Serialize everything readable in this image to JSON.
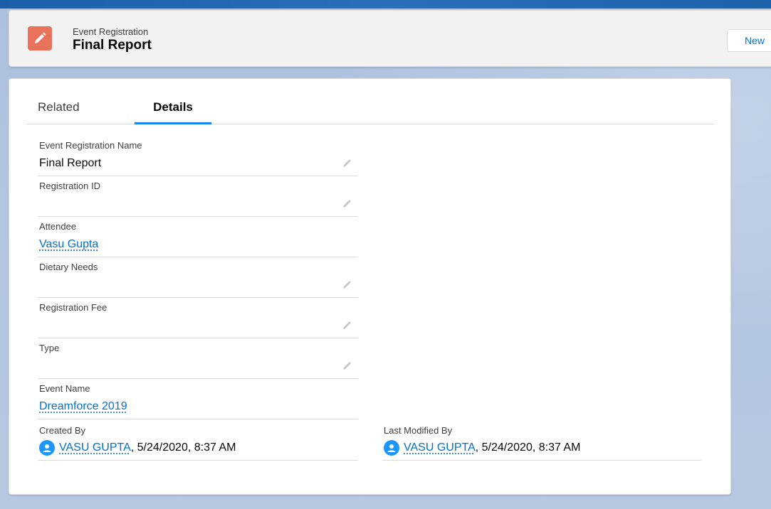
{
  "header": {
    "object_label": "Event Registration",
    "record_title": "Final Report",
    "new_button_label": "New",
    "icon_color": "#e8735a"
  },
  "tabs": [
    {
      "label": "Related",
      "active": false
    },
    {
      "label": "Details",
      "active": true
    }
  ],
  "fields": [
    {
      "label": "Event Registration Name",
      "value": "Final Report",
      "is_link": false,
      "editable": true
    },
    {
      "label": "Registration ID",
      "value": "",
      "is_link": false,
      "editable": true
    },
    {
      "label": "Attendee",
      "value": "Vasu Gupta",
      "is_link": true,
      "editable": false
    },
    {
      "label": "Dietary Needs",
      "value": "",
      "is_link": false,
      "editable": true
    },
    {
      "label": "Registration Fee",
      "value": "",
      "is_link": false,
      "editable": true
    },
    {
      "label": "Type",
      "value": "",
      "is_link": false,
      "editable": true
    },
    {
      "label": "Event Name",
      "value": "Dreamforce 2019",
      "is_link": true,
      "editable": false
    }
  ],
  "created_by": {
    "label": "Created By",
    "user": "VASU GUPTA",
    "timestamp": ", 5/24/2020, 8:37 AM"
  },
  "last_modified_by": {
    "label": "Last Modified By",
    "user": "VASU GUPTA",
    "timestamp": ", 5/24/2020, 8:37 AM"
  },
  "icons": {
    "record_icon": "pencil-icon",
    "edit_icon": "pencil-edit-icon",
    "avatar_icon": "user-avatar-icon"
  },
  "colors": {
    "link": "#0070d2",
    "active_tab_underline": "#1589ee",
    "avatar": "#1b96ff"
  }
}
